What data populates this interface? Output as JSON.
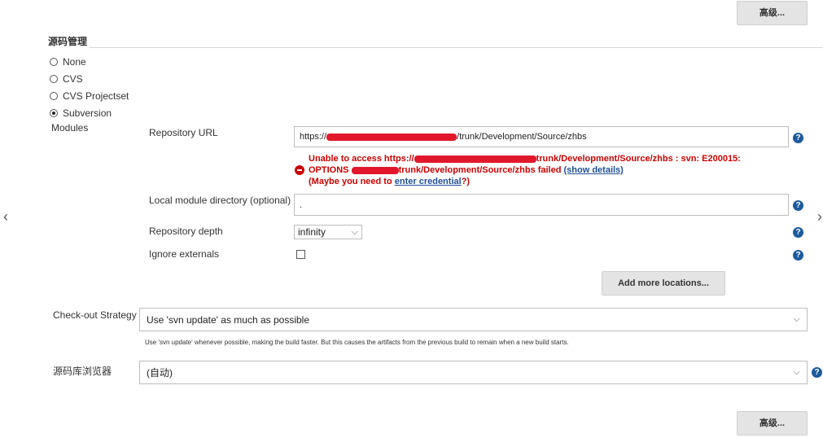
{
  "top_advanced_label": "高级...",
  "bottom_advanced_label": "高级...",
  "scm_section": {
    "title": "源码管理",
    "options": [
      {
        "label": "None",
        "checked": false
      },
      {
        "label": "CVS",
        "checked": false
      },
      {
        "label": "CVS Projectset",
        "checked": false
      },
      {
        "label": "Subversion",
        "checked": true
      }
    ],
    "modules_label": "Modules"
  },
  "repository": {
    "url_label": "Repository URL",
    "url_value_prefix": "https://",
    "url_value_suffix": "/trunk/Development/Source/zhbs",
    "error_line1_prefix": "Unable to access https://",
    "error_line1_suffix": "trunk/Development/Source/zhbs : svn: E200015:",
    "error_line2_prefix": "OPTIONS ",
    "error_line2_suffix": "trunk/Development/Source/zhbs failed",
    "show_details": "(show details)",
    "error_line3_prefix": "(Maybe you need to ",
    "enter_credential": "enter credential",
    "error_line3_suffix": "?)",
    "local_dir_label": "Local module directory (optional)",
    "local_dir_value": ".",
    "depth_label": "Repository depth",
    "depth_value": "infinity",
    "ignore_externals_label": "Ignore externals",
    "ignore_externals_checked": false,
    "add_more_label": "Add more locations..."
  },
  "checkout": {
    "label": "Check-out Strategy",
    "value": "Use 'svn update' as much as possible",
    "description": "Use 'svn update' whenever possible, making the build faster. But this causes the artifacts from the previous build to remain when a new build starts."
  },
  "browser": {
    "label": "源码库浏览器",
    "value": "(自动)"
  },
  "nav": {
    "left_arrow": "‹",
    "right_arrow": "›"
  },
  "help_glyph": "?",
  "chevron_glyph": "⌵",
  "colors": {
    "error": "#cc0000",
    "link": "#1f4f99",
    "help": "#1d5a9c",
    "button_bg": "#e4e4e4"
  }
}
